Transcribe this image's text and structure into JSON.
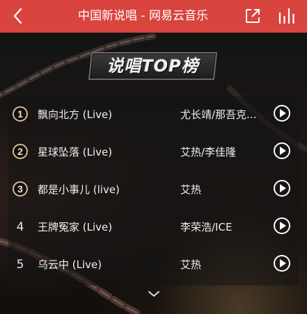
{
  "header": {
    "title": "中国新说唱 - 网易云音乐",
    "background": "#d9443e",
    "icons": {
      "back": "back-arrow-icon",
      "share": "share-icon",
      "chart": "chart-bars-icon"
    }
  },
  "banner": {
    "title": "说唱TOP榜"
  },
  "songs": [
    {
      "rank": "1",
      "title": "飘向北方 (Live)",
      "artist": "尤长靖/那吾克...",
      "highlight": true
    },
    {
      "rank": "2",
      "title": "星球坠落 (Live)",
      "artist": "艾热/李佳隆",
      "highlight": true
    },
    {
      "rank": "3",
      "title": "都是小事儿 (live)",
      "artist": "艾热",
      "highlight": true
    },
    {
      "rank": "4",
      "title": "王牌冤家 (Live)",
      "artist": "李荣浩/ICE",
      "highlight": false
    },
    {
      "rank": "5",
      "title": "乌云中 (Live)",
      "artist": "艾热",
      "highlight": false
    }
  ],
  "footer": {
    "expand_icon": "chevron-down-icon"
  }
}
